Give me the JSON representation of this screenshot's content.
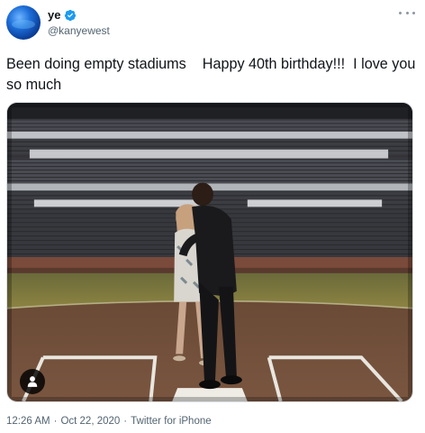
{
  "author": {
    "display_name": "ye",
    "handle": "@kanyewest",
    "verified_icon": "verified-badge-icon",
    "avatar_icon": "blue-globe-avatar"
  },
  "tweet": {
    "text": "Been doing empty stadiums    Happy 40th birthday!!!  I love you so much"
  },
  "media": {
    "user_tag_icon": "person-icon"
  },
  "meta": {
    "time": "12:26 AM",
    "date": "Oct 22, 2020",
    "separator": "·",
    "source": "Twitter for iPhone"
  },
  "colors": {
    "verified": "#1d9bf0",
    "secondary_text": "#536471",
    "primary_text": "#0f1419"
  }
}
